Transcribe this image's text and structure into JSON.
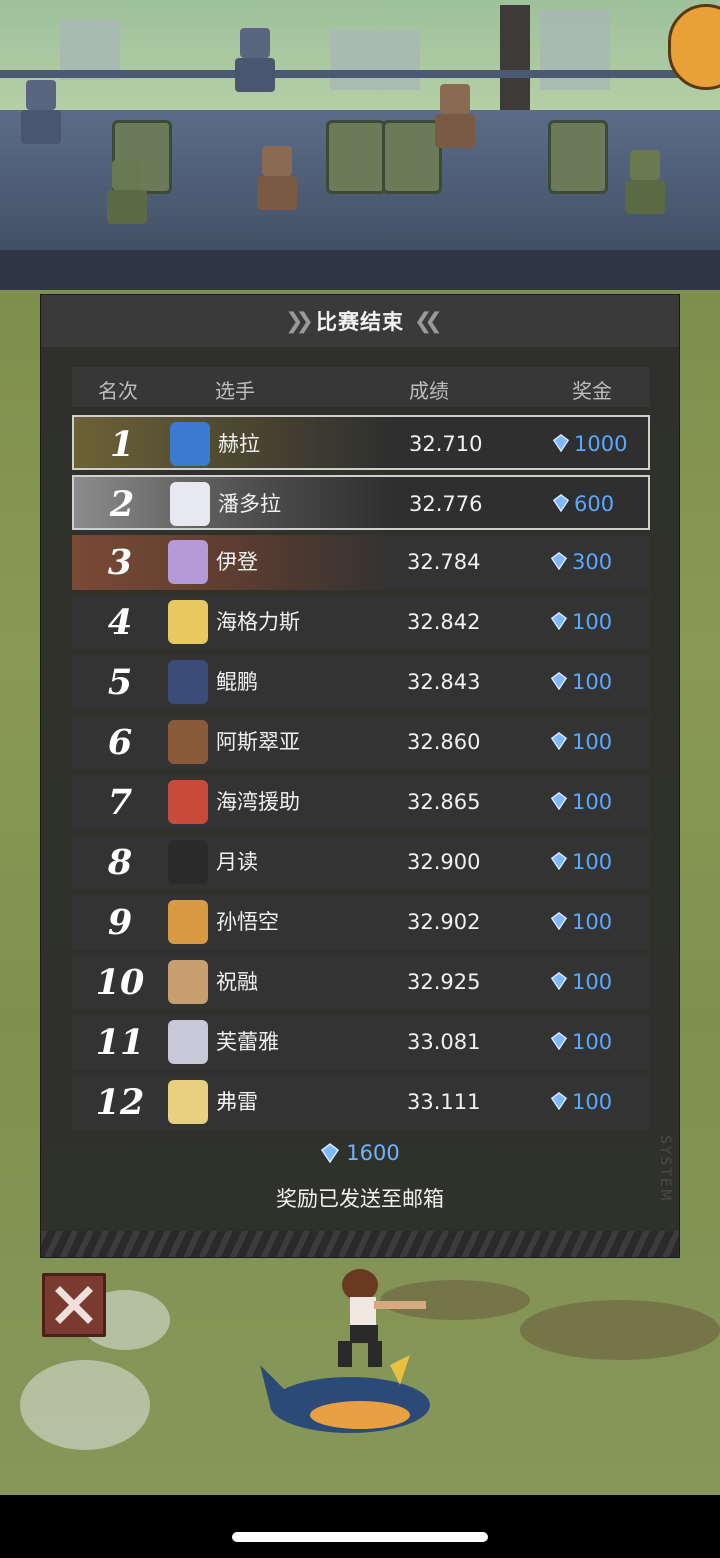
{
  "panel": {
    "title": "比赛结束",
    "columns": {
      "rank": "名次",
      "player": "选手",
      "score": "成绩",
      "prize": "奖金"
    },
    "rows": [
      {
        "rank": "1",
        "name": "赫拉",
        "score": "32.710",
        "prize": "1000"
      },
      {
        "rank": "2",
        "name": "潘多拉",
        "score": "32.776",
        "prize": "600"
      },
      {
        "rank": "3",
        "name": "伊登",
        "score": "32.784",
        "prize": "300"
      },
      {
        "rank": "4",
        "name": "海格力斯",
        "score": "32.842",
        "prize": "100"
      },
      {
        "rank": "5",
        "name": "鲲鹏",
        "score": "32.843",
        "prize": "100"
      },
      {
        "rank": "6",
        "name": "阿斯翠亚",
        "score": "32.860",
        "prize": "100"
      },
      {
        "rank": "7",
        "name": "海湾援助",
        "score": "32.865",
        "prize": "100"
      },
      {
        "rank": "8",
        "name": "月读",
        "score": "32.900",
        "prize": "100"
      },
      {
        "rank": "9",
        "name": "孙悟空",
        "score": "32.902",
        "prize": "100"
      },
      {
        "rank": "10",
        "name": "祝融",
        "score": "32.925",
        "prize": "100"
      },
      {
        "rank": "11",
        "name": "芙蕾雅",
        "score": "33.081",
        "prize": "100"
      },
      {
        "rank": "12",
        "name": "弗雷",
        "score": "33.111",
        "prize": "100"
      }
    ],
    "total": "1600",
    "notice": "奖励已发送至邮箱",
    "watermark": "SYSTEM"
  },
  "icons": {
    "gem": "diamond-gem-icon",
    "close": "close-icon"
  },
  "colors": {
    "prize_text": "#5aa8ff",
    "gold_row": "#6d6236",
    "silver_row": "#8c8c8c",
    "bronze_row": "#7a4a35",
    "close_button": "#7a3a30"
  },
  "avatar_colors": [
    "#3a7ad0",
    "#e8e8f0",
    "#b59ad8",
    "#e8c860",
    "#3c4c78",
    "#8a5a3a",
    "#c84a3a",
    "#2a2a2a",
    "#d89a40",
    "#c8a070",
    "#c8c8d8",
    "#e8d080"
  ]
}
